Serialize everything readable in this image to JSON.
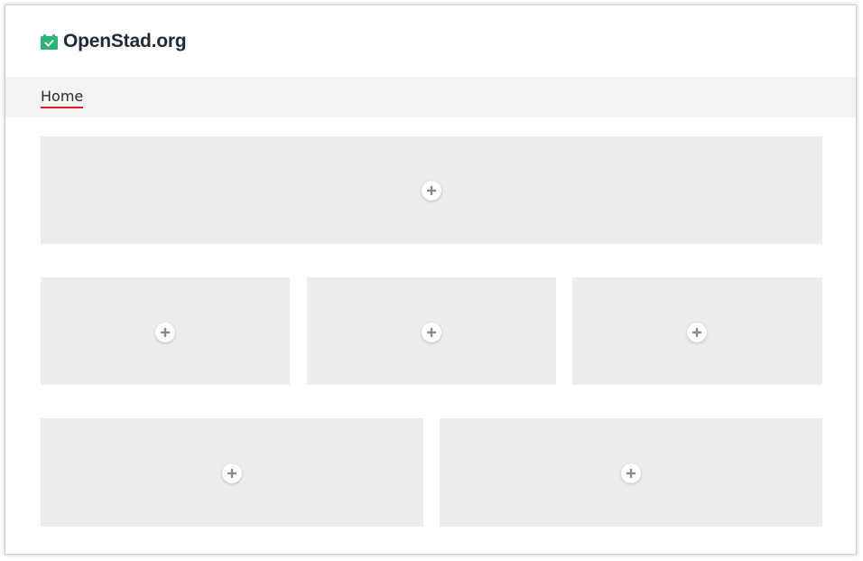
{
  "header": {
    "logo_text": "OpenStad.org",
    "logo_icon": "calendar-check-icon"
  },
  "nav": {
    "items": [
      {
        "label": "Home",
        "active": true
      }
    ]
  },
  "colors": {
    "brand_green": "#2bb673",
    "brand_text": "#1c2b3a",
    "active_underline": "#e01e1e",
    "nav_background": "#f3f3f3",
    "block_background": "#ededed"
  },
  "content": {
    "rows": [
      {
        "columns": 1
      },
      {
        "columns": 3
      },
      {
        "columns": 2
      }
    ],
    "add_icon": "plus-icon"
  }
}
